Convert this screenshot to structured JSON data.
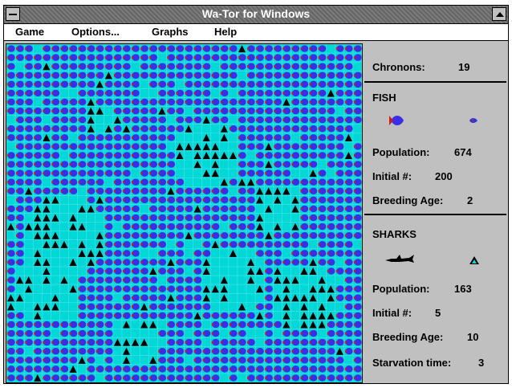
{
  "window": {
    "title": "Wa-Tor for Windows"
  },
  "menu": [
    "Game",
    "Options...",
    "Graphs",
    "Help"
  ],
  "stats": {
    "chronons_label": "Chronons:",
    "chronons": "19"
  },
  "fish": {
    "header": "FISH",
    "population_label": "Population:",
    "population": "674",
    "initial_label": "Initial #:",
    "initial": "200",
    "breeding_label": "Breeding Age:",
    "breeding": "2"
  },
  "sharks": {
    "header": "SHARKS",
    "population_label": "Population:",
    "population": "163",
    "initial_label": "Initial #:",
    "initial": "5",
    "breeding_label": "Breeding Age:",
    "breeding": "10",
    "starvation_label": "Starvation time:",
    "starvation": "3"
  },
  "icons": {
    "fish": "fish-icon",
    "shark": "shark-icon"
  },
  "colors": {
    "water": "#00d8d8",
    "fish": "#3a2ee8",
    "fish_fin": "#d01a1a",
    "shark": "#000000",
    "panel": "#c0c0c0",
    "titlebar": "#7b7b7b"
  }
}
